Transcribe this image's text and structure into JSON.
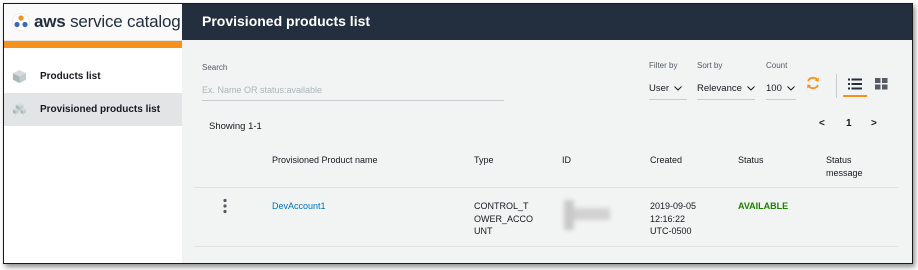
{
  "app": {
    "logo_prefix": "aws",
    "logo_suffix": " service catalog",
    "logo_icon": "aws-service-catalog-logo",
    "brand_color": "#f7911e",
    "header_color": "#232f3e"
  },
  "sidebar": {
    "items": [
      {
        "label": "Products list",
        "icon": "cube-icon",
        "active": false
      },
      {
        "label": "Provisioned products list",
        "icon": "cubes-icon",
        "active": true
      }
    ]
  },
  "header": {
    "title": "Provisioned products list"
  },
  "toolbar": {
    "search_label": "Search",
    "search_placeholder": "Ex. Name OR status:available",
    "filter_label": "Filter by",
    "filter_value": "User",
    "sort_label": "Sort by",
    "sort_value": "Relevance",
    "count_label": "Count",
    "count_value": "100",
    "refresh_icon": "refresh-icon",
    "view_list_icon": "list-view-icon",
    "view_grid_icon": "grid-view-icon",
    "active_view": "list"
  },
  "results": {
    "showing": "Showing 1-1",
    "pager": {
      "prev": "<",
      "page": "1",
      "next": ">"
    }
  },
  "table": {
    "columns": [
      "Provisioned Product name",
      "Type",
      "ID",
      "Created",
      "Status",
      "Status\nmessage"
    ],
    "rows": [
      {
        "name": "DevAccount1",
        "type": "CONTROL_T\nOWER_ACCO\nUNT",
        "id": "",
        "created": "2019-09-05\n12:16:22\nUTC-0500",
        "status": "AVAILABLE",
        "status_message": ""
      }
    ]
  }
}
